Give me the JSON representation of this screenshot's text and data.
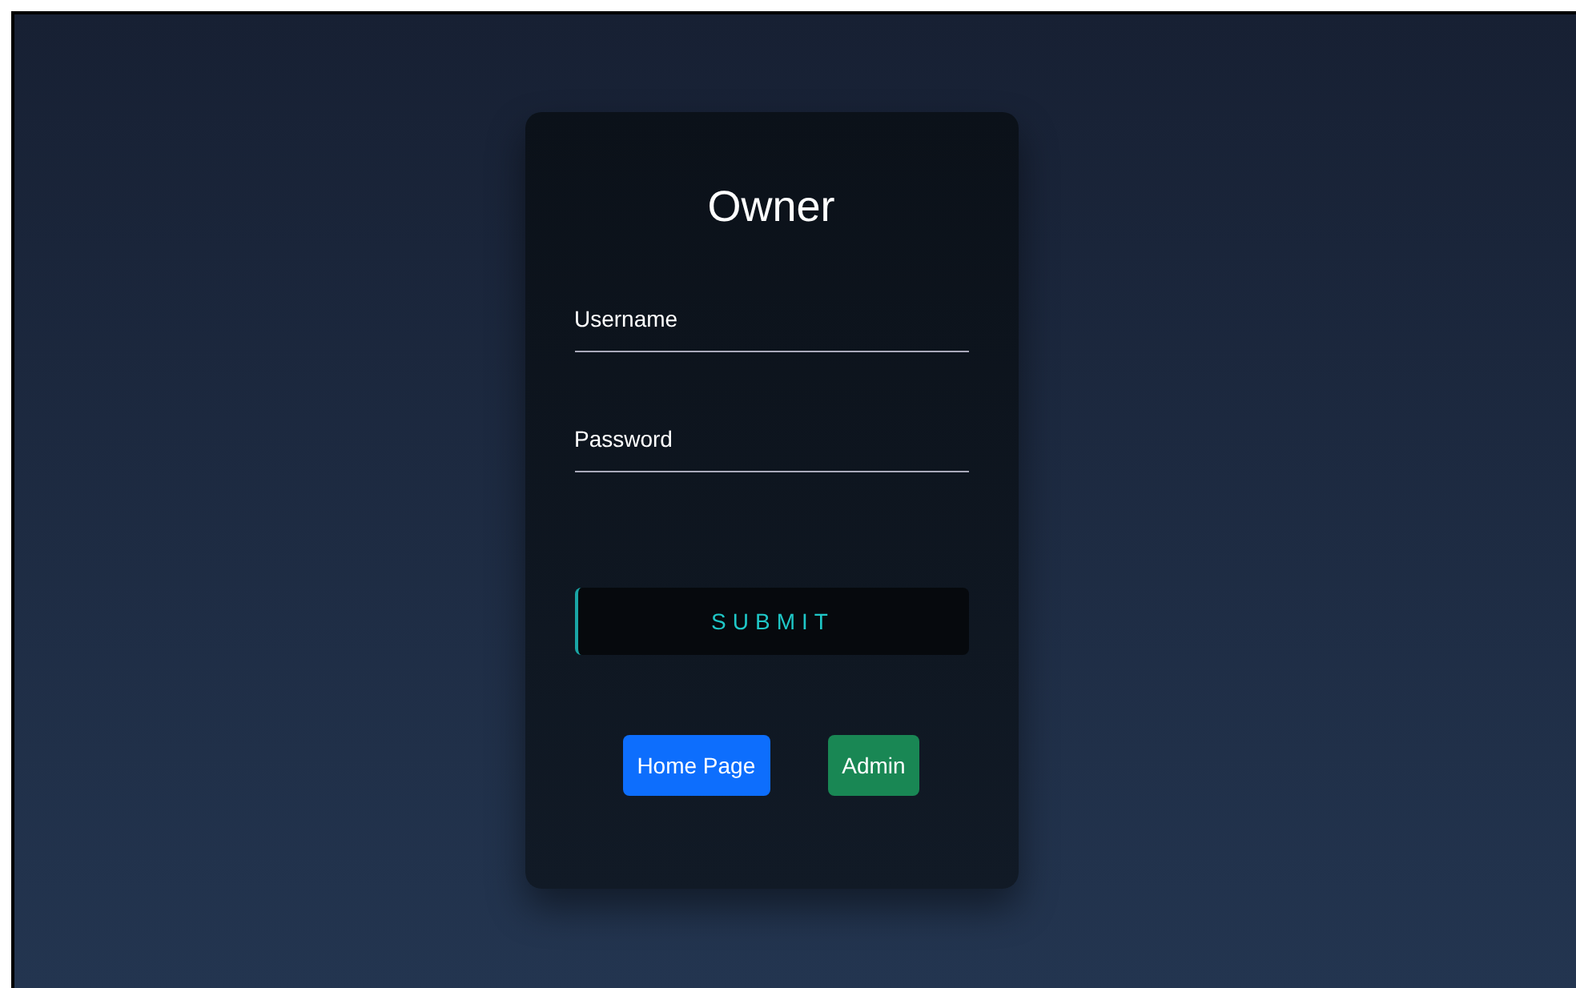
{
  "card": {
    "title": "Owner",
    "fields": [
      {
        "placeholder": "Username"
      },
      {
        "placeholder": "Password"
      }
    ],
    "submit": "SUBMIT",
    "links": [
      {
        "label": "Home Page",
        "kind": "primary"
      },
      {
        "label": "Admin",
        "kind": "success"
      }
    ]
  }
}
